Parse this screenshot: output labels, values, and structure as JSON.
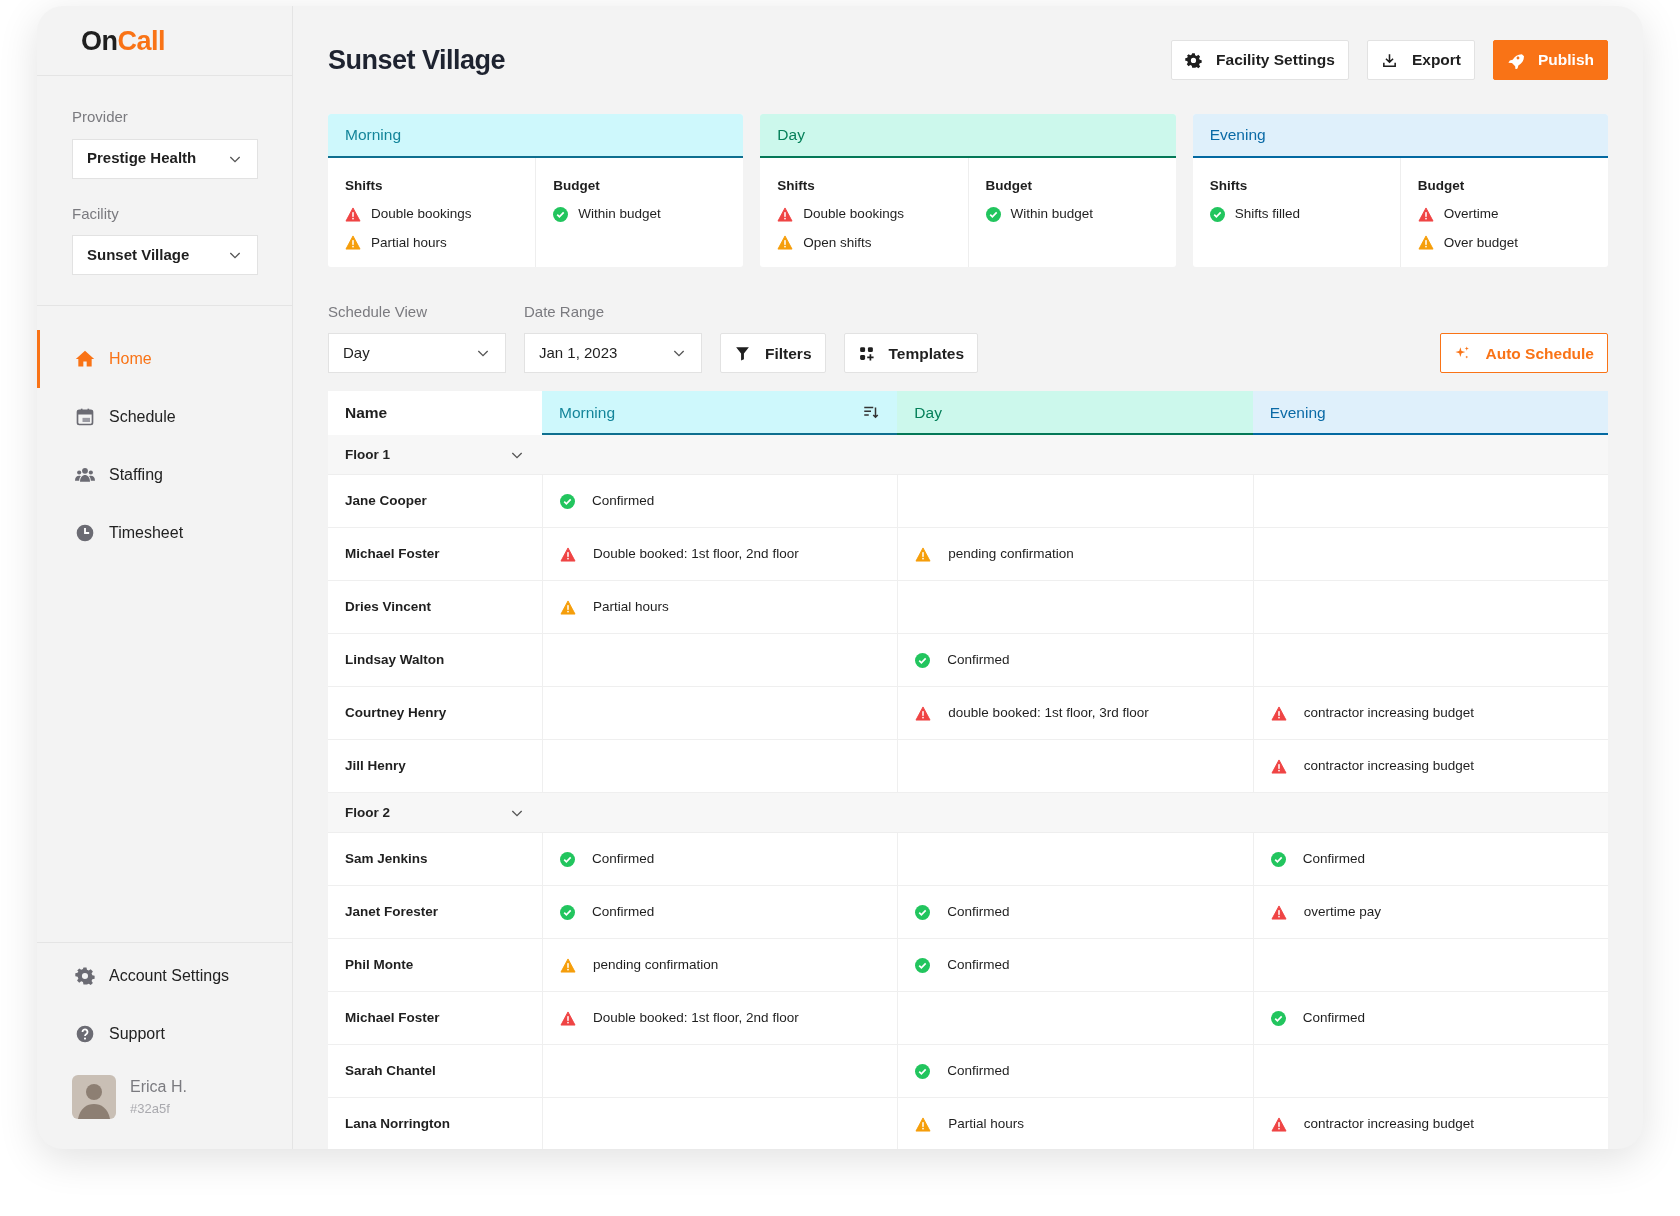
{
  "logo": {
    "part_1": "On",
    "part_2": "Call"
  },
  "sidebar": {
    "provider": {
      "label": "Provider",
      "value": "Prestige Health"
    },
    "facility": {
      "label": "Facility",
      "value": "Sunset Village"
    },
    "nav": [
      {
        "label": "Home",
        "selected": true
      },
      {
        "label": "Schedule",
        "selected": false
      },
      {
        "label": "Staffing",
        "selected": false
      },
      {
        "label": "Timesheet",
        "selected": false
      }
    ],
    "bottom_nav": [
      {
        "label": "Account Settings"
      },
      {
        "label": "Support"
      }
    ],
    "user": {
      "name": "Erica H.",
      "id": "#32a5f"
    }
  },
  "header": {
    "title": "Sunset Village",
    "buttons": [
      {
        "label": "Facility Settings",
        "kind": "default"
      },
      {
        "label": "Export",
        "kind": "default"
      },
      {
        "label": "Publish",
        "kind": "primary"
      }
    ]
  },
  "summary": [
    {
      "title": "Morning",
      "kind": "morning",
      "shifts": {
        "label": "Shifts",
        "items": [
          {
            "kind": "error",
            "text": "Double bookings"
          },
          {
            "kind": "warning",
            "text": "Partial hours"
          }
        ]
      },
      "budget": {
        "label": "Budget",
        "items": [
          {
            "kind": "ok",
            "text": "Within budget"
          }
        ]
      }
    },
    {
      "title": "Day",
      "kind": "day",
      "shifts": {
        "label": "Shifts",
        "items": [
          {
            "kind": "error",
            "text": "Double bookings"
          },
          {
            "kind": "warning",
            "text": "Open shifts"
          }
        ]
      },
      "budget": {
        "label": "Budget",
        "items": [
          {
            "kind": "ok",
            "text": "Within budget"
          }
        ]
      }
    },
    {
      "title": "Evening",
      "kind": "evening",
      "shifts": {
        "label": "Shifts",
        "items": [
          {
            "kind": "ok",
            "text": "Shifts filled"
          }
        ]
      },
      "budget": {
        "label": "Budget",
        "items": [
          {
            "kind": "error",
            "text": "Overtime"
          },
          {
            "kind": "warning",
            "text": "Over budget"
          }
        ]
      }
    }
  ],
  "toolbar": {
    "schedule_view": {
      "label": "Schedule View",
      "value": "Day"
    },
    "date_range": {
      "label": "Date Range",
      "value": "Jan 1, 2023"
    },
    "buttons": [
      {
        "label": "Filters"
      },
      {
        "label": "Templates"
      }
    ],
    "auto_schedule": {
      "label": "Auto Schedule"
    }
  },
  "table": {
    "columns": [
      {
        "label": "Name",
        "kind": "name",
        "sort_icon": false
      },
      {
        "label": "Morning",
        "kind": "morning",
        "sort_icon": true
      },
      {
        "label": "Day",
        "kind": "day",
        "sort_icon": false
      },
      {
        "label": "Evening",
        "kind": "evening",
        "sort_icon": false
      }
    ],
    "groups": [
      {
        "label": "Floor 1",
        "expanded": true,
        "rows": [
          {
            "name": "Jane Cooper",
            "cells": [
              {
                "kind": "ok",
                "text": "Confirmed"
              },
              null,
              null
            ]
          },
          {
            "name": "Michael Foster",
            "cells": [
              {
                "kind": "error",
                "text": "Double booked: 1st floor, 2nd floor"
              },
              {
                "kind": "warning",
                "text": "pending confirmation"
              },
              null
            ]
          },
          {
            "name": "Dries Vincent",
            "cells": [
              {
                "kind": "warning",
                "text": "Partial hours"
              },
              null,
              null
            ]
          },
          {
            "name": "Lindsay Walton",
            "cells": [
              null,
              {
                "kind": "ok",
                "text": "Confirmed"
              },
              null
            ]
          },
          {
            "name": "Courtney Henry",
            "cells": [
              null,
              {
                "kind": "error",
                "text": "double booked: 1st floor, 3rd floor"
              },
              {
                "kind": "error",
                "text": "contractor increasing budget"
              }
            ]
          },
          {
            "name": "Jill Henry",
            "cells": [
              null,
              null,
              {
                "kind": "error",
                "text": "contractor increasing budget"
              }
            ]
          }
        ]
      },
      {
        "label": "Floor 2",
        "expanded": true,
        "rows": [
          {
            "name": "Sam Jenkins",
            "cells": [
              {
                "kind": "ok",
                "text": "Confirmed"
              },
              null,
              {
                "kind": "ok",
                "text": "Confirmed"
              }
            ]
          },
          {
            "name": "Janet Forester",
            "cells": [
              {
                "kind": "ok",
                "text": "Confirmed"
              },
              {
                "kind": "ok",
                "text": "Confirmed"
              },
              {
                "kind": "error",
                "text": "overtime pay"
              }
            ]
          },
          {
            "name": "Phil Monte",
            "cells": [
              {
                "kind": "warning",
                "text": "pending confirmation"
              },
              {
                "kind": "ok",
                "text": "Confirmed"
              },
              null
            ]
          },
          {
            "name": "Michael Foster",
            "cells": [
              {
                "kind": "error",
                "text": "Double booked: 1st floor, 2nd floor"
              },
              null,
              {
                "kind": "ok",
                "text": "Confirmed"
              }
            ]
          },
          {
            "name": "Sarah Chantel",
            "cells": [
              null,
              {
                "kind": "ok",
                "text": "Confirmed"
              },
              null
            ]
          },
          {
            "name": "Lana Norrington",
            "cells": [
              null,
              {
                "kind": "warning",
                "text": "Partial hours"
              },
              {
                "kind": "error",
                "text": "contractor increasing budget"
              }
            ]
          }
        ]
      }
    ]
  }
}
